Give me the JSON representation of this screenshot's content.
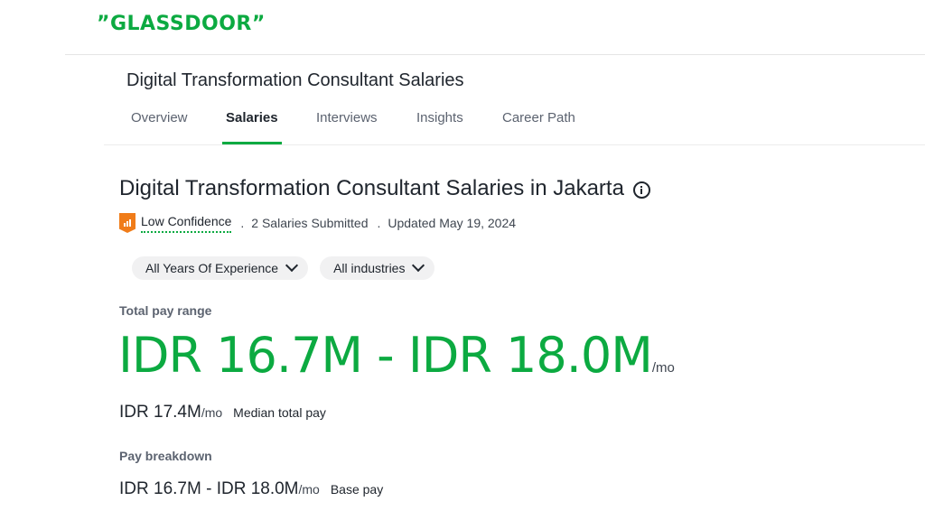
{
  "header": {
    "logo": "”GLASSDOOR”"
  },
  "job": {
    "title": "Digital Transformation Consultant Salaries"
  },
  "tabs": [
    {
      "label": "Overview"
    },
    {
      "label": "Salaries"
    },
    {
      "label": "Interviews"
    },
    {
      "label": "Insights"
    },
    {
      "label": "Career Path"
    }
  ],
  "main": {
    "title": "Digital Transformation Consultant Salaries in Jakarta",
    "confidence": "Low Confidence",
    "separator": ".",
    "salaries_submitted": "2 Salaries Submitted",
    "updated": "Updated May 19, 2024"
  },
  "filters": [
    {
      "label": "All Years Of Experience"
    },
    {
      "label": "All industries"
    }
  ],
  "pay": {
    "total_label": "Total pay range",
    "range": "IDR 16.7M - IDR 18.0M",
    "range_unit": "/mo",
    "median_value": "IDR 17.4M",
    "median_unit": "/mo",
    "median_label": "Median total pay",
    "breakdown_label": "Pay breakdown",
    "base_value": "IDR 16.7M - IDR 18.0M",
    "base_unit": "/mo",
    "base_label": "Base pay"
  },
  "colors": {
    "brand_green": "#0caa41",
    "confidence_orange": "#f07c19"
  }
}
